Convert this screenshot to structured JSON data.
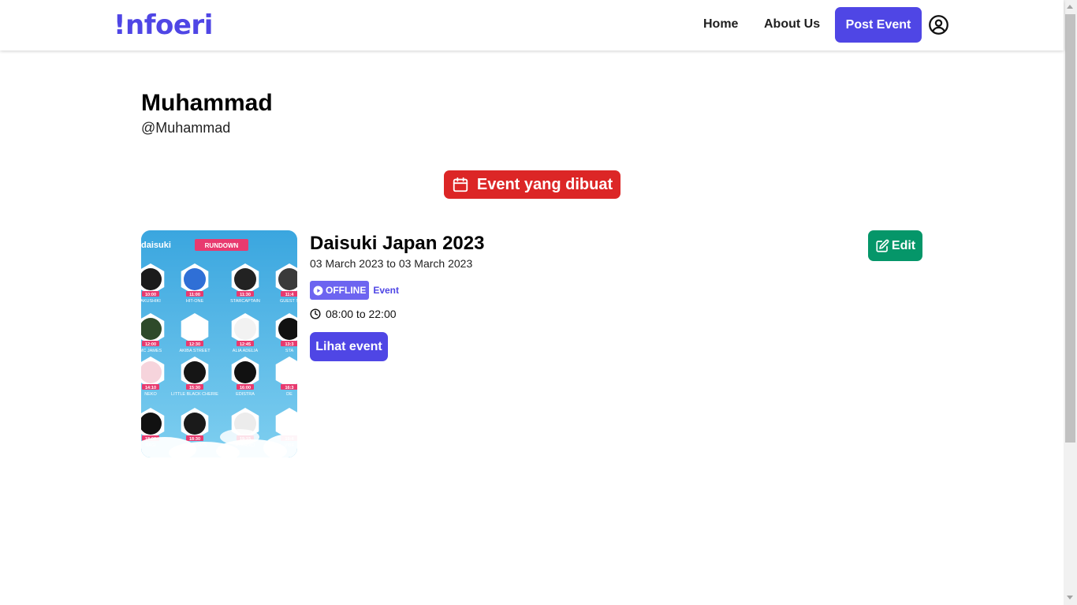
{
  "navbar": {
    "logo": "!nfoeri",
    "links": [
      "Home",
      "About Us"
    ],
    "post_button": "Post Event",
    "user_icon": "user-circle-icon"
  },
  "profile": {
    "name": "Muhammad",
    "handle": "@Muhammad"
  },
  "tab": {
    "label": "Event yang dibuat",
    "icon": "calendar-icon"
  },
  "event": {
    "title": "Daisuki Japan 2023",
    "date": "03 March 2023 to 03 March 2023",
    "mode": "OFFLINE",
    "type": "Event",
    "time": "08:00 to 22:00",
    "view_button": "Lihat event",
    "edit_button": "Edit",
    "poster": {
      "header": "RUNDOWN",
      "brand": "daisuki",
      "slots": [
        {
          "time": "10:00",
          "name": "AKUSHIKI"
        },
        {
          "time": "11:00",
          "name": "HIT-ONE"
        },
        {
          "time": "11:30",
          "name": "STARCAPTAIN"
        },
        {
          "time": "11:4",
          "name": "GUEST S"
        },
        {
          "time": "12:00",
          "name": "MC JAMES"
        },
        {
          "time": "12:30",
          "name": "AKIBA STREET"
        },
        {
          "time": "12:45",
          "name": "ALIA ADELIA"
        },
        {
          "time": "13:3",
          "name": "STA"
        },
        {
          "time": "14:10",
          "name": "NEKO"
        },
        {
          "time": "15:30",
          "name": "LITTLE BLACK CHERIE"
        },
        {
          "time": "16:00",
          "name": "EDISTRA"
        },
        {
          "time": "16:3",
          "name": "DE"
        },
        {
          "time": "18:00",
          "name": "NAGI"
        },
        {
          "time": "18:30",
          "name": "NOWADAYS"
        },
        {
          "time": "19:15",
          "name": "AYA RIKO"
        },
        {
          "time": "19:4",
          "name": "VIBE"
        }
      ]
    }
  },
  "colors": {
    "brand": "#4f46e5",
    "tab": "#dc2626",
    "edit": "#059669",
    "offline_badge": "#6d64f0",
    "poster_bg": "#4fb3e3",
    "poster_accent": "#e83a6f"
  }
}
